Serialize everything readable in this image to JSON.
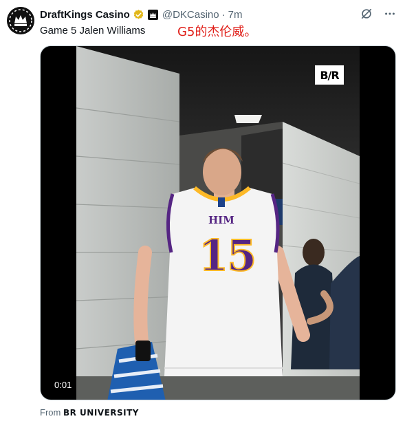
{
  "tweet": {
    "display_name": "DraftKings Casino",
    "handle": "@DKCasino",
    "separator": "·",
    "time": "7m",
    "text": "Game 5 Jalen Williams",
    "annotation": "G5的杰伦威。"
  },
  "icons": {
    "avatar": "draftkings-crown-icon",
    "verified": "gold-verified-badge-icon",
    "affiliate": "affiliate-badge-icon",
    "grok": "grok-icon",
    "more": "more-icon"
  },
  "media": {
    "watermark": "B/R",
    "timestamp": "0:01",
    "jersey_name": "HIM",
    "jersey_number": "15"
  },
  "from": {
    "prefix": "From",
    "source": "BR UNIVERSITY"
  },
  "colors": {
    "verified_gold": "#e2b719",
    "annotation_red": "#e0201a",
    "secondary_text": "#536471",
    "jersey_purple": "#552583",
    "jersey_gold": "#fdb927"
  }
}
